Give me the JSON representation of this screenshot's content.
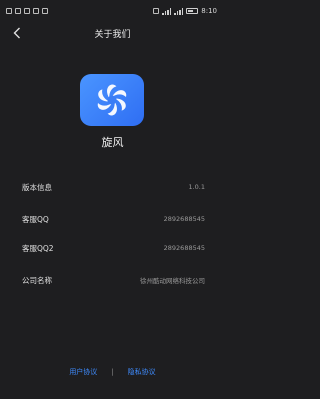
{
  "status": {
    "time": "8:10"
  },
  "header": {
    "title": "关于我们",
    "back_icon": "chevron-left-icon"
  },
  "app": {
    "name": "旋风",
    "logo_icon": "pinwheel-logo-icon"
  },
  "info": [
    {
      "label": "版本信息",
      "value": "1.0.1"
    },
    {
      "label": "客服QQ",
      "value": "2892688545"
    },
    {
      "label": "客服QQ2",
      "value": "2892688545"
    },
    {
      "label": "公司名称",
      "value": "徐州酷动网络科技公司"
    }
  ],
  "footer": {
    "user_agreement": "用户协议",
    "separator": "|",
    "privacy_policy": "隐私协议"
  },
  "colors": {
    "background": "#1e1e20",
    "logo": "#3b82f6",
    "link": "#3f8cff"
  }
}
